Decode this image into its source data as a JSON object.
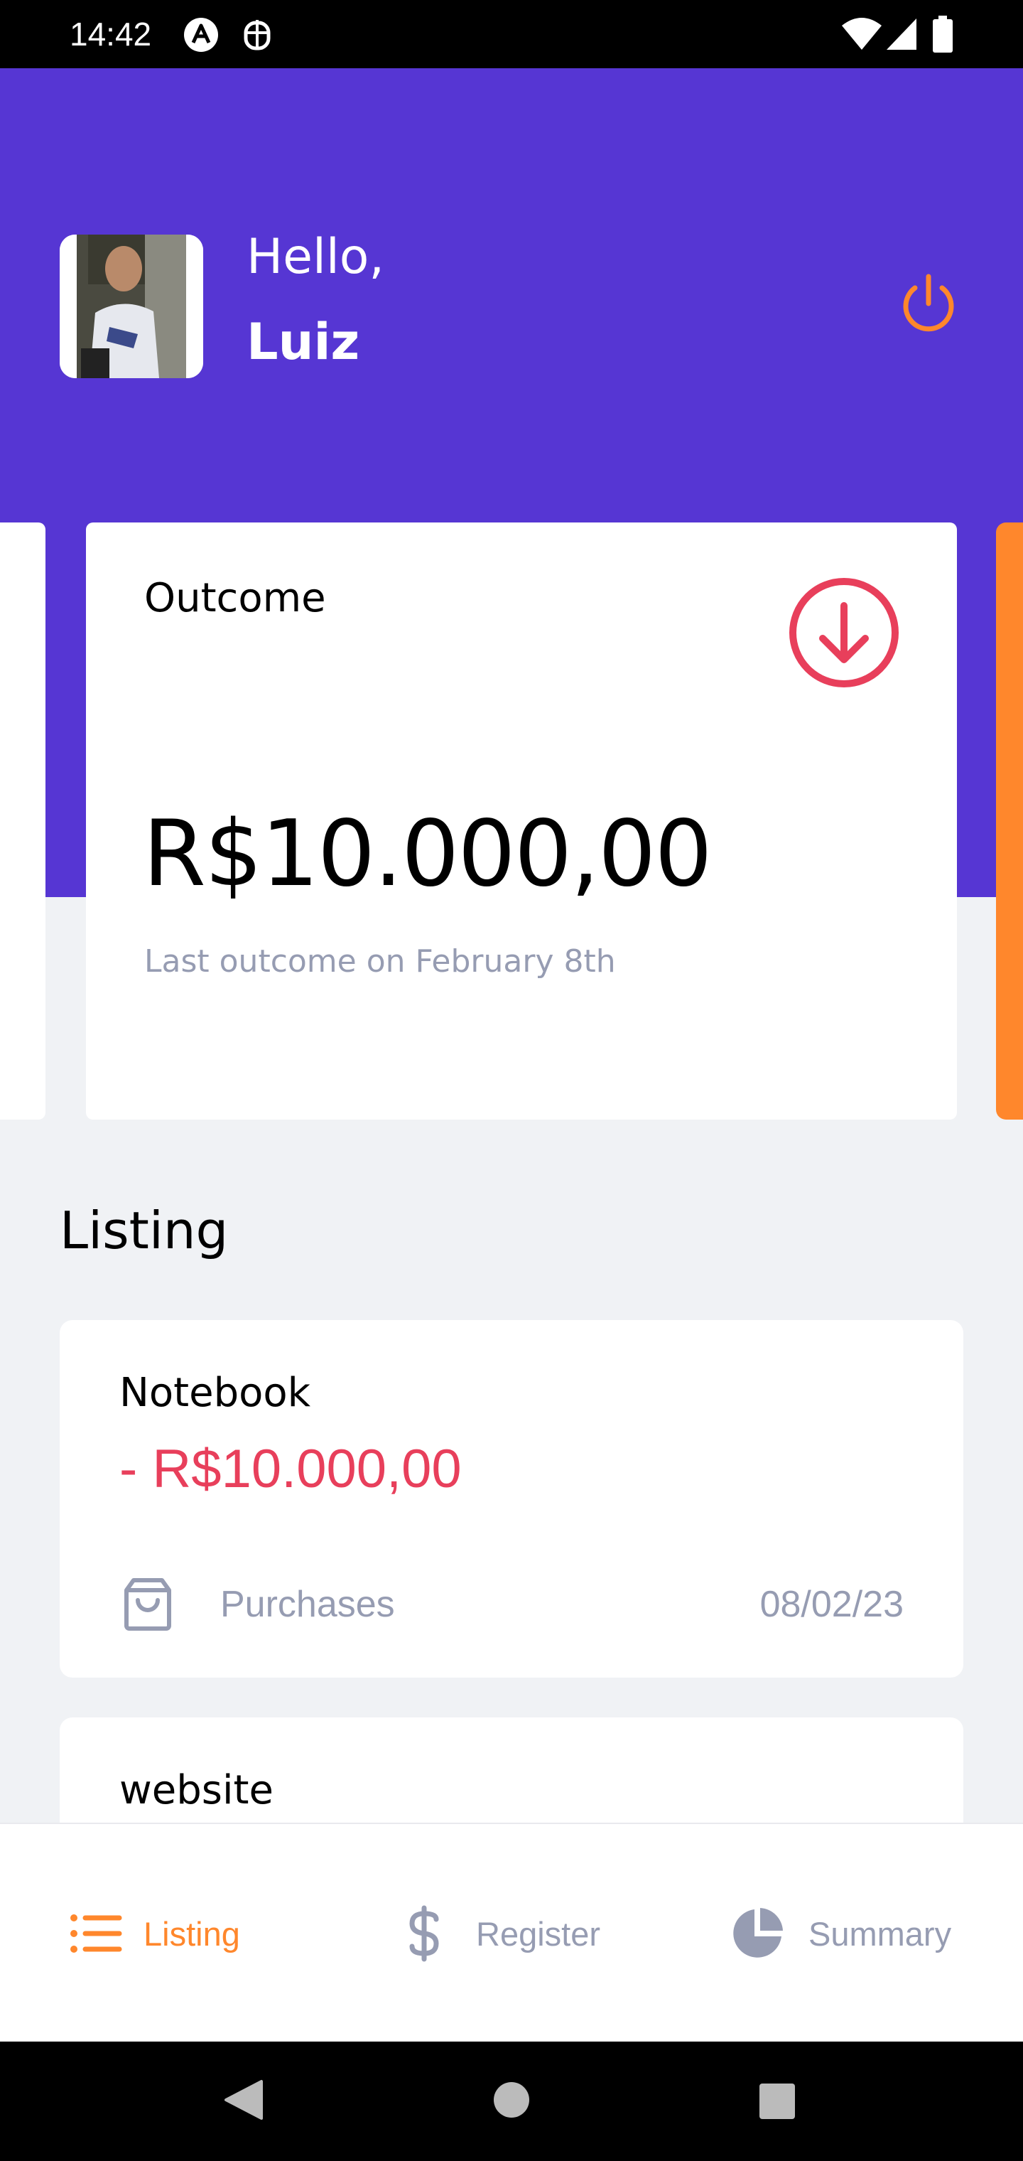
{
  "status_bar": {
    "time": "14:42"
  },
  "header": {
    "greeting": "Hello,",
    "user_name": "Luiz"
  },
  "highlight_card": {
    "title": "Outcome",
    "amount": "R$10.000,00",
    "last_transaction": "Last outcome on February 8th"
  },
  "listing": {
    "title": "Listing",
    "transactions": [
      {
        "name": "Notebook",
        "amount": "- R$10.000,00",
        "category": "Purchases",
        "date": "08/02/23"
      },
      {
        "name": "website"
      }
    ]
  },
  "tabs": [
    {
      "label": "Listing",
      "icon": "list-icon",
      "active": true
    },
    {
      "label": "Register",
      "icon": "dollar-icon",
      "active": false
    },
    {
      "label": "Summary",
      "icon": "pie-chart-icon",
      "active": false
    }
  ],
  "colors": {
    "primary": "#5636D3",
    "secondary": "#FF872C",
    "attention": "#E83F5B",
    "text_light": "#969CB2",
    "background": "#F0F2F5"
  }
}
